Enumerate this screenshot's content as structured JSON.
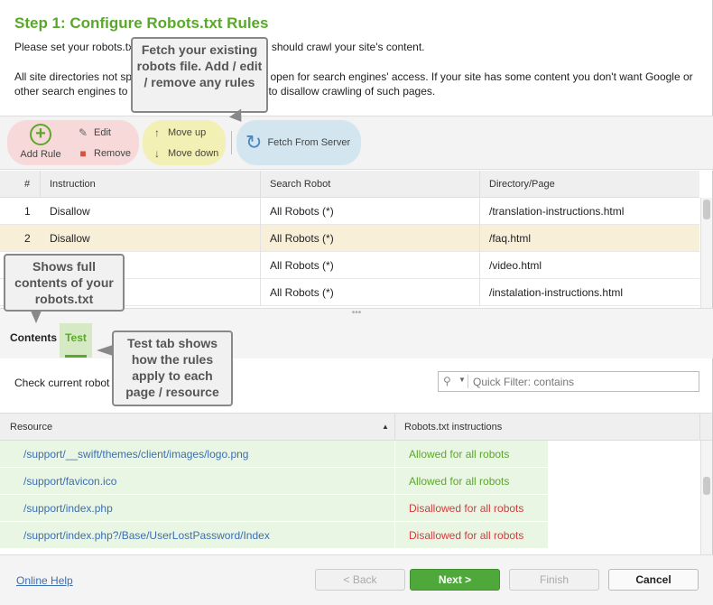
{
  "header": {
    "title": "Step 1: Configure Robots.txt Rules",
    "intro_line1": "Please set your robots.txt rules to tell search engines should crawl your site's content.",
    "intro_line2": "All site directories not specified in your robots file are open for search engines' access. If your site has some content you don't want Google or other search engines to crawl, set up robots.txt rules to disallow crawling of such pages."
  },
  "toolbar": {
    "add_rule": "Add Rule",
    "edit": "Edit",
    "remove": "Remove",
    "move_up": "Move up",
    "move_down": "Move down",
    "fetch": "Fetch From Server"
  },
  "rules_table": {
    "columns": [
      "#",
      "Instruction",
      "Search Robot",
      "Directory/Page"
    ],
    "rows": [
      {
        "num": "1",
        "instruction": "Disallow",
        "robot": "All Robots (*)",
        "path": "/translation-instructions.html"
      },
      {
        "num": "2",
        "instruction": "Disallow",
        "robot": "All Robots (*)",
        "path": "/faq.html"
      },
      {
        "num": "3",
        "instruction": "",
        "robot": "All Robots (*)",
        "path": "/video.html"
      },
      {
        "num": "4",
        "instruction": "",
        "robot": "All Robots (*)",
        "path": "/instalation-instructions.html"
      }
    ]
  },
  "tabs": {
    "contents": "Contents",
    "test": "Test"
  },
  "test_panel": {
    "check_label": "Check current robot",
    "filter_placeholder": "Quick Filter: contains"
  },
  "resources_table": {
    "columns": [
      "Resource",
      "Robots.txt instructions"
    ],
    "sort_indicator": "▲",
    "rows": [
      {
        "resource": "/support/__swift/themes/client/images/logo.png",
        "status": "Allowed for all robots",
        "allowed": true
      },
      {
        "resource": "/support/favicon.ico",
        "status": "Allowed for all robots",
        "allowed": true
      },
      {
        "resource": "/support/index.php",
        "status": "Disallowed for all robots",
        "allowed": false
      },
      {
        "resource": "/support/index.php?/Base/UserLostPassword/Index",
        "status": "Disallowed for all robots",
        "allowed": false
      }
    ]
  },
  "footer": {
    "help": "Online Help",
    "back": "< Back",
    "next": "Next >",
    "finish": "Finish",
    "cancel": "Cancel"
  },
  "callouts": {
    "fetch": "Fetch your existing robots file. Add / edit / remove any rules",
    "contents": "Shows full contents of your robots.txt",
    "test": "Test tab shows how the rules apply to each page / resource"
  },
  "icons": {
    "add": "plus-circle-icon",
    "edit": "pencil-icon",
    "remove": "trash-icon",
    "move_up": "arrow-up-icon",
    "move_down": "arrow-down-icon",
    "fetch": "refresh-icon",
    "search": "search-icon"
  },
  "colors": {
    "accent_green": "#5aa82a",
    "link_blue": "#3a6fb0",
    "disallowed_red": "#d23c3c",
    "selected_row": "#f7efd8"
  }
}
